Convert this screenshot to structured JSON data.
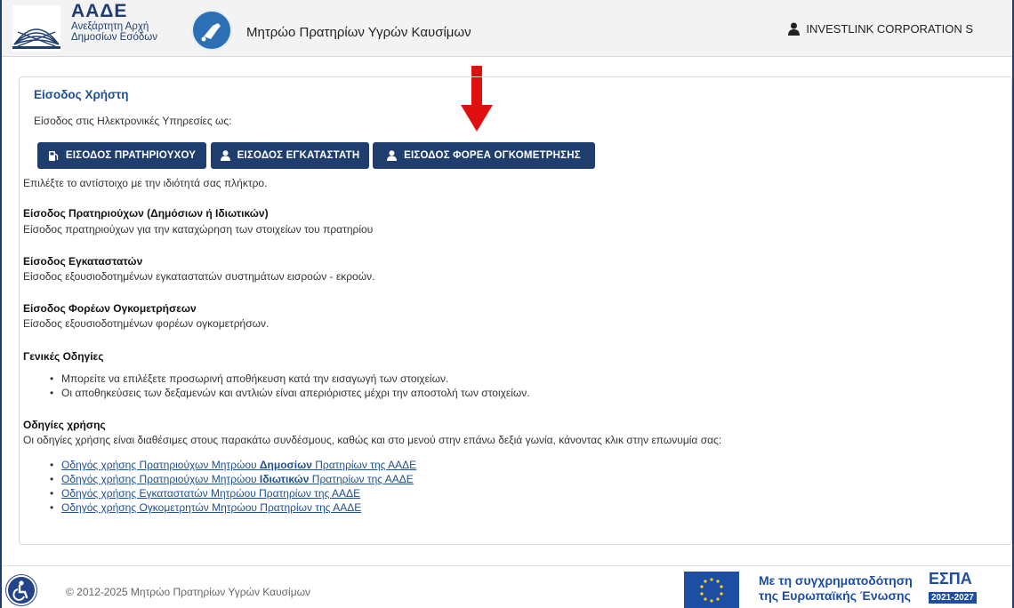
{
  "header": {
    "brand_title": "ΑΑΔΕ",
    "brand_line1": "Ανεξάρτητη Αρχή",
    "brand_line2": "Δημοσίων Εσόδων",
    "app_title": "Μητρώο Πρατηρίων Υγρών Καυσίμων",
    "user_name": "INVESTLINK CORPORATION S"
  },
  "panel": {
    "title": "Είσοδος Χρήστη",
    "intro": "Είσοδος στις Ηλεκτρονικές Υπηρεσίες ως:",
    "buttons": [
      {
        "label": "ΕΙΣΟΔΟΣ ΠΡΑΤΗΡΙΟΥΧΟΥ",
        "icon": "fuel-pump-icon"
      },
      {
        "label": "ΕΙΣΟΔΟΣ ΕΓΚΑΤΑΣΤΑΤΗ",
        "icon": "user-icon"
      },
      {
        "label": "ΕΙΣΟΔΟΣ ΦΟΡΕΑ ΟΓΚΟΜΕΤΡΗΣΗΣ",
        "icon": "user-icon"
      }
    ],
    "choose_hint": "Επιλέξτε το αντίστοιχο με την ιδιότητά σας πλήκτρο.",
    "sections": [
      {
        "heading": "Είσοδος Πρατηριούχων (Δημόσιων ή Ιδιωτικών)",
        "text": "Είσοδος πρατηριούχων για την καταχώρηση των στοιχείων του πρατηρίου"
      },
      {
        "heading": "Είσοδος Εγκαταστατών",
        "text": "Είσοδος εξουσιοδοτημένων εγκαταστατών συστημάτων εισροών - εκροών."
      },
      {
        "heading": "Είσοδος Φορέων Ογκομετρήσεων",
        "text": "Είσοδος εξουσιοδοτημένων φορέων ογκομετρήσων."
      }
    ],
    "general": {
      "heading": "Γενικές Οδηγίες",
      "items": [
        "Μπορείτε να επιλέξετε προσωρινή αποθήκευση κατά την εισαγωγή των στοιχείων.",
        "Οι αποθηκεύσεις των δεξαμενών και αντλιών είναι απεριόριστες μέχρι την αποστολή των στοιχείων."
      ]
    },
    "usage": {
      "heading": "Οδηγίες χρήσης",
      "text": "Οι οδηγίες χρήσης είναι διαθέσιμες στους παρακάτω συνδέσμους, καθώς και στο μενού στην επάνω δεξιά γωνία, κάνοντας κλικ στην επωνυμία σας:",
      "links": [
        {
          "before": "Οδηγός χρήσης Πρατηριούχων Μητρώου ",
          "bold": "Δημοσίων",
          "after": " Πρατηρίων της ΑΑΔΕ"
        },
        {
          "before": "Οδηγός χρήσης Πρατηριούχων Μητρώου ",
          "bold": "Ιδιωτικών",
          "after": " Πρατηρίων της ΑΑΔΕ"
        },
        {
          "before": "Οδηγός χρήσης Εγκαταστατών Μητρώου Πρατηρίων της ΑΑΔΕ",
          "bold": "",
          "after": ""
        },
        {
          "before": "Οδηγός χρήσης Ογκομετρητών Μητρώου Πρατηρίων της ΑΑΔΕ",
          "bold": "",
          "after": ""
        }
      ]
    }
  },
  "footer": {
    "copyright": "© 2012-2025 Μητρώο Πρατηρίων Υγρών Καυσίμων",
    "cofund_line1": "Με τη συγχρηματοδότηση",
    "cofund_line2": "της Ευρωπαϊκής Ένωσης",
    "espa_title": "ΕΣΠΑ",
    "espa_years": "2021-2027"
  },
  "colors": {
    "primary": "#1f3e6e",
    "link": "#1f4f91",
    "arrow": "#e01010"
  }
}
